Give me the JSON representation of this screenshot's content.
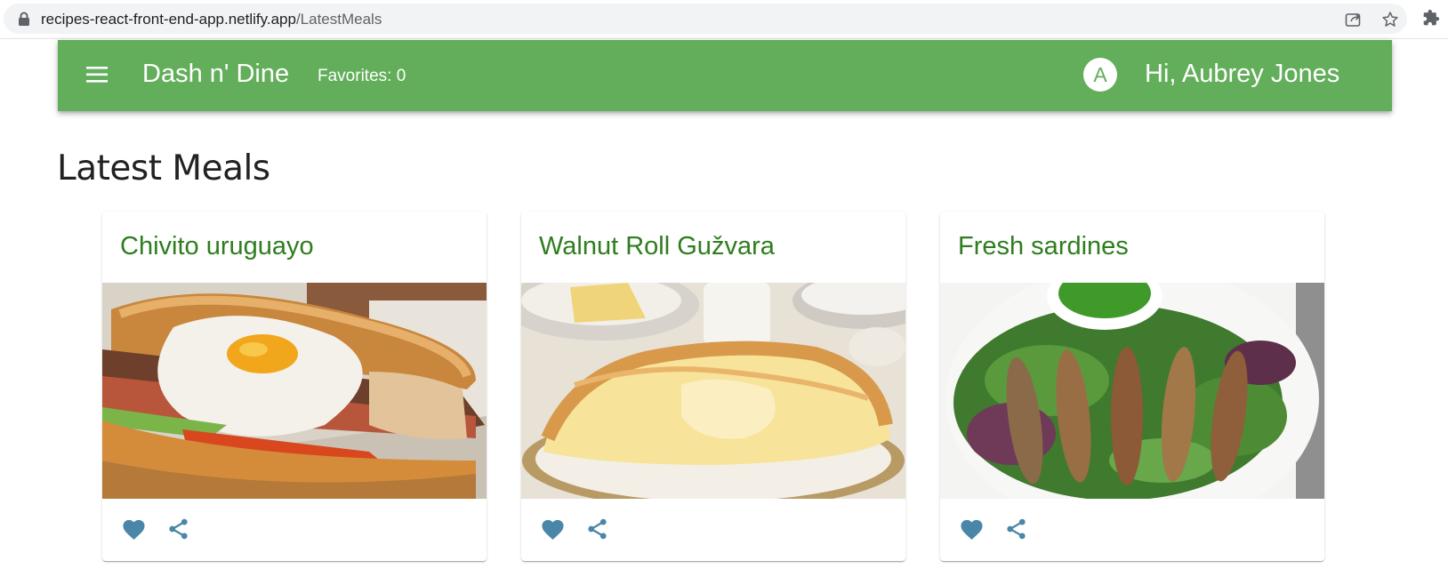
{
  "browser": {
    "url_host": "recipes-react-front-end-app.netlify.app",
    "url_path": "/LatestMeals"
  },
  "app_bar": {
    "title": "Dash n' Dine",
    "favorites": "Favorites: 0",
    "avatar_letter": "A",
    "greeting": "Hi, Aubrey Jones"
  },
  "page": {
    "heading": "Latest Meals"
  },
  "meals": [
    {
      "title": "Chivito uruguayo"
    },
    {
      "title": "Walnut Roll Gužvara"
    },
    {
      "title": "Fresh sardines"
    }
  ],
  "icons": {
    "menu": "menu-icon",
    "favorite": "heart-icon",
    "share": "share-icon",
    "lock": "lock-icon",
    "star": "star-icon",
    "extensions": "puzzle-icon"
  },
  "colors": {
    "app_bar": "#62ae5a",
    "card_title": "#2e7d1e",
    "action_icon": "#4a86a8"
  }
}
